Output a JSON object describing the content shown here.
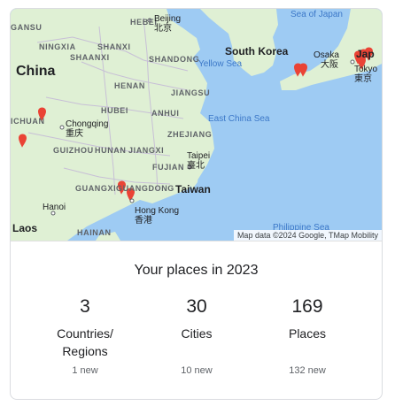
{
  "map": {
    "attribution": "Map data ©2024 Google, TMap Mobility",
    "countries": {
      "china": "China",
      "south_korea": "South Korea",
      "japan": "Jap",
      "taiwan": "Taiwan",
      "laos": "Laos"
    },
    "seas": {
      "sea_of_japan": "Sea of Japan",
      "yellow_sea": "Yellow Sea",
      "east_china_sea": "East China Sea",
      "philippine_sea": "Philippine Sea"
    },
    "provinces": {
      "gansu": "GANSU",
      "ningxia": "NINGXIA",
      "shanxi": "SHANXI",
      "shaanxi": "SHAANXI",
      "hebei": "HEBEI",
      "shandong": "SHANDONG",
      "henan": "HENAN",
      "jiangsu": "JIANGSU",
      "hubei": "HUBEI",
      "anhui": "ANHUI",
      "sichuan": "ICHUAN",
      "zhejiang": "ZHEJIANG",
      "guizhou": "GUIZHOU",
      "hunan": "HUNAN",
      "jiangxi": "JIANGXI",
      "fujian": "FUJIAN",
      "guangxi": "GUANGXI",
      "guangdong": "GUANGDONG",
      "hainan": "HAINAN"
    },
    "cities": {
      "beijing": "Beijing",
      "beijing_native": "北京",
      "chongqing": "Chongqing",
      "chongqing_native": "重庆",
      "taipei": "Taipei",
      "taipei_native": "臺北",
      "hongkong": "Hong Kong",
      "hongkong_native": "香港",
      "hanoi": "Hanoi",
      "osaka": "Osaka",
      "osaka_native": "大阪",
      "tokyo": "Tokyo",
      "tokyo_native": "東京"
    },
    "colors": {
      "water": "#9ecbf3",
      "land": "#dff0d4",
      "pin": "#ea4335",
      "border": "#b9b2c9"
    }
  },
  "summary": {
    "title": "Your places in 2023",
    "stats": [
      {
        "value": "3",
        "label_line1": "Countries/",
        "label_line2": "Regions",
        "new": "1 new"
      },
      {
        "value": "30",
        "label_line1": "Cities",
        "label_line2": "",
        "new": "10 new"
      },
      {
        "value": "169",
        "label_line1": "Places",
        "label_line2": "",
        "new": "132 new"
      }
    ]
  }
}
